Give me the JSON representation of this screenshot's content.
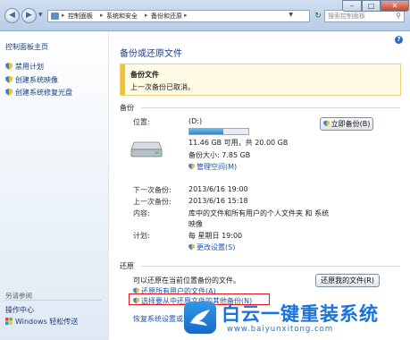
{
  "address": {
    "crumbs": [
      "控制面板",
      "系统和安全",
      "备份和还原"
    ]
  },
  "search": {
    "placeholder": "搜索控制面板"
  },
  "sidebar": {
    "home": "控制面板主页",
    "tasks": [
      "禁用计划",
      "创建系统映像",
      "创建系统修复光盘"
    ],
    "see_also": "另请参阅",
    "see_items": [
      "操作中心",
      "Windows 轻松传送"
    ]
  },
  "main": {
    "title": "备份或还原文件",
    "warning": {
      "title": "备份文件",
      "message": "上一次备份已取消。"
    },
    "backup_section": "备份",
    "location_label": "位置:",
    "drive": "(D:)",
    "usage_fraction": 0.57,
    "free_text": "11.46 GB 可用，共 20.00 GB",
    "backup_size": "备份大小: 7.85 GB",
    "manage_space": "管理空间(M)",
    "backup_now": "立即备份(B)",
    "next_label": "下一次备份:",
    "next_value": "2013/6/16 19:00",
    "last_label": "上一次备份:",
    "last_value": "2013/6/16 15:18",
    "content_label": "内容:",
    "content_value_1": "库中的文件和所有用户的个人文件夹 和 系统",
    "content_value_2": "映像",
    "schedule_label": "计划:",
    "schedule_value": "每 星期日 19:00",
    "change_settings": "更改设置(S)",
    "restore_section": "还原",
    "restore_text": "可以还原在当前位置备份的文件。",
    "restore_button": "还原我的文件(R)",
    "restore_all": "还原所有用户的文件(A)",
    "select_other": "选择要从中还原文件的其他备份(N)",
    "recover_link": "恢复系统设置或计算机(C)"
  },
  "watermark": {
    "brand": "白云一键重装系统",
    "url": "www.baiyunxitong.com"
  },
  "colors": {
    "link": "#1b53b0",
    "highlight_border": "#e3161b",
    "warning_bar": "#f1c232"
  }
}
